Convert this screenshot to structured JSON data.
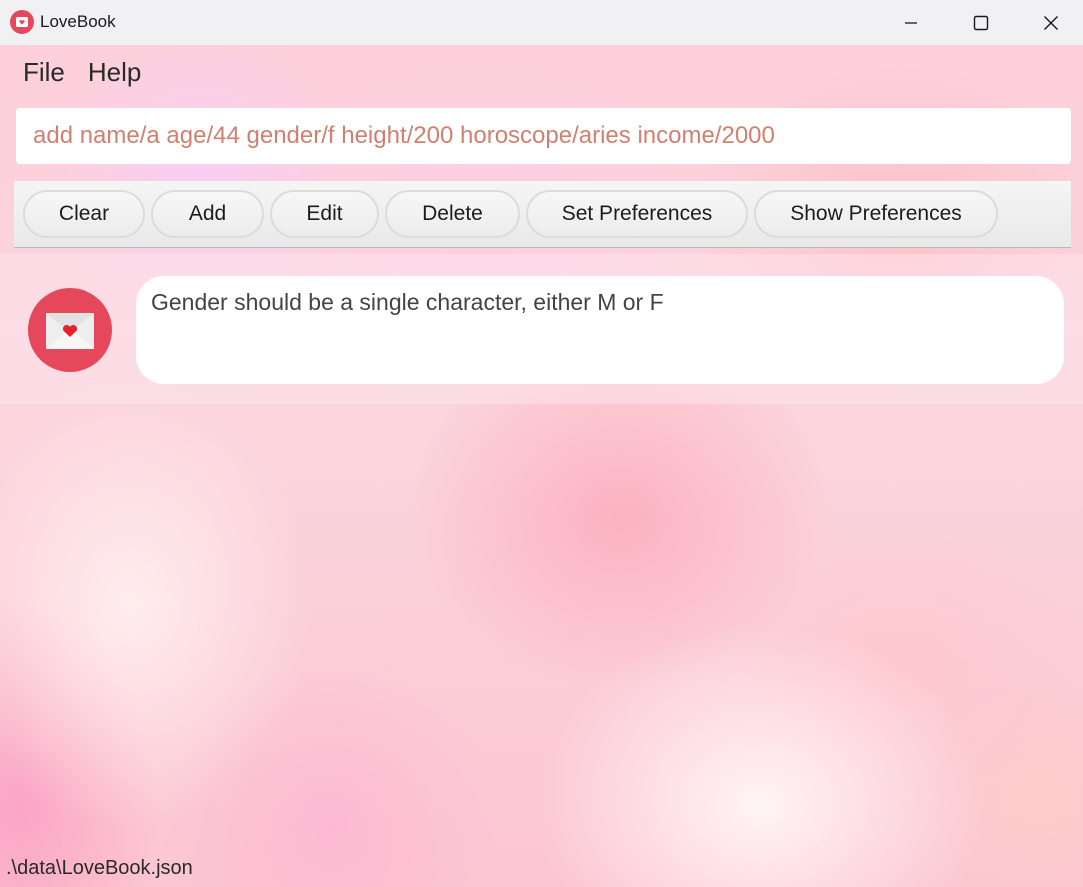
{
  "window": {
    "title": "LoveBook",
    "icon": "mail-heart-icon",
    "controls": [
      "minimize-icon",
      "maximize-icon",
      "close-icon"
    ]
  },
  "menu": {
    "file": "File",
    "help": "Help"
  },
  "command": {
    "value": "add name/a age/44 gender/f height/200 horoscope/aries income/2000"
  },
  "toolbar": {
    "clear": "Clear",
    "add": "Add",
    "edit": "Edit",
    "delete": "Delete",
    "set_preferences": "Set Preferences",
    "show_preferences": "Show Preferences"
  },
  "result": {
    "icon": "envelope-heart-icon",
    "message": "Gender should be a single character, either M or F"
  },
  "status": {
    "file_path": ".\\data\\LoveBook.json"
  },
  "colors": {
    "accent": "#e5485a",
    "command_text": "#d08070",
    "heart": "#e2232e"
  }
}
